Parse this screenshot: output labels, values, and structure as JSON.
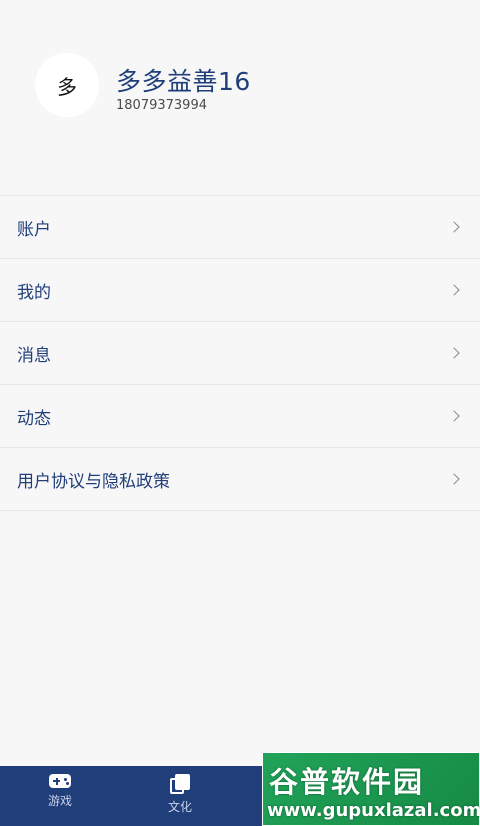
{
  "profile": {
    "avatar_char": "多",
    "username": "多多益善16",
    "phone": "18079373994"
  },
  "menu": [
    {
      "label": "账户"
    },
    {
      "label": "我的"
    },
    {
      "label": "消息"
    },
    {
      "label": "动态"
    },
    {
      "label": "用户协议与隐私政策"
    }
  ],
  "tabbar": {
    "tabs": [
      {
        "label": "游戏",
        "icon": "gamepad-icon"
      },
      {
        "label": "文化",
        "icon": "book-icon"
      }
    ]
  },
  "watermark": {
    "title": "谷普软件园",
    "url": "www.gupuxlazal.com"
  },
  "colors": {
    "accent": "#1f3e7a",
    "background": "#f7f7f7",
    "watermark": "#21a35a"
  }
}
